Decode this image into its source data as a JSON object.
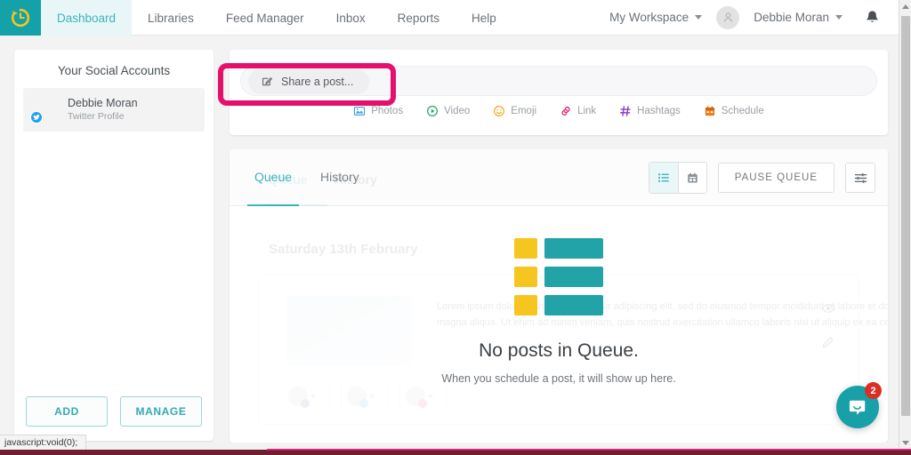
{
  "app": {
    "logo_icon": "clock-recycle-icon",
    "brand_teal": "#14a1a8",
    "accent_pink": "#e5106e",
    "accent_yellow": "#f6c51f"
  },
  "topnav": {
    "items": [
      {
        "label": "Dashboard",
        "active": true
      },
      {
        "label": "Libraries",
        "active": false
      },
      {
        "label": "Feed Manager",
        "active": false
      },
      {
        "label": "Inbox",
        "active": false
      },
      {
        "label": "Reports",
        "active": false
      },
      {
        "label": "Help",
        "active": false
      }
    ],
    "workspace": "My Workspace",
    "user": "Debbie Moran",
    "bell_icon": "bell-icon",
    "user_icon": "user-avatar-icon"
  },
  "sidebar": {
    "title": "Your Social Accounts",
    "accounts": [
      {
        "name": "Debbie Moran",
        "type": "Twitter Profile",
        "badge_icon": "twitter-icon"
      }
    ],
    "add_label": "ADD",
    "manage_label": "MANAGE"
  },
  "composer": {
    "share_label": "Share a post...",
    "share_icon": "compose-pencil-icon",
    "placeholder": "Share a post...",
    "tools": [
      {
        "label": "Photos",
        "icon": "image-icon",
        "color": "#4aa3e0"
      },
      {
        "label": "Video",
        "icon": "play-icon",
        "color": "#1fa463"
      },
      {
        "label": "Emoji",
        "icon": "smiley-icon",
        "color": "#f0a81e"
      },
      {
        "label": "Link",
        "icon": "link-icon",
        "color": "#e5106e"
      },
      {
        "label": "Hashtags",
        "icon": "hashtag-icon",
        "color": "#8c3fc4"
      },
      {
        "label": "Schedule",
        "icon": "calendar-icon",
        "color": "#ee7a1a"
      }
    ]
  },
  "queue": {
    "tabs": [
      {
        "label": "Queue",
        "active": true
      },
      {
        "label": "History",
        "active": false
      }
    ],
    "view_list_icon": "list-view-icon",
    "view_calendar_icon": "calendar-view-icon",
    "pause_label": "PAUSE QUEUE",
    "filter_icon": "sliders-filter-icon",
    "empty_title": "No posts in Queue.",
    "empty_subtitle": "When you schedule a post, it will show up here."
  },
  "ghost": {
    "tabs": [
      "Queue",
      "History"
    ],
    "date_heading": "Saturday 13th February",
    "body_line1": "Lorem ipsum dolor sit amet, consectetur adipiscing elit, sed do eiusmod tempor incididunt ut labore et dolore",
    "body_line2": "magna aliqua. Ut enim ad minim veniam, quis nostrud exercitation ullamco laboris nisi ut aliquip ex ea commodo",
    "action_icons": [
      "eye-icon",
      "pencil-icon"
    ]
  },
  "intercom": {
    "icon": "chat-bubble-icon",
    "unread_count": "2"
  },
  "browser": {
    "status_text": "javascript:void(0);",
    "scrollbar": "vertical-scrollbar"
  }
}
